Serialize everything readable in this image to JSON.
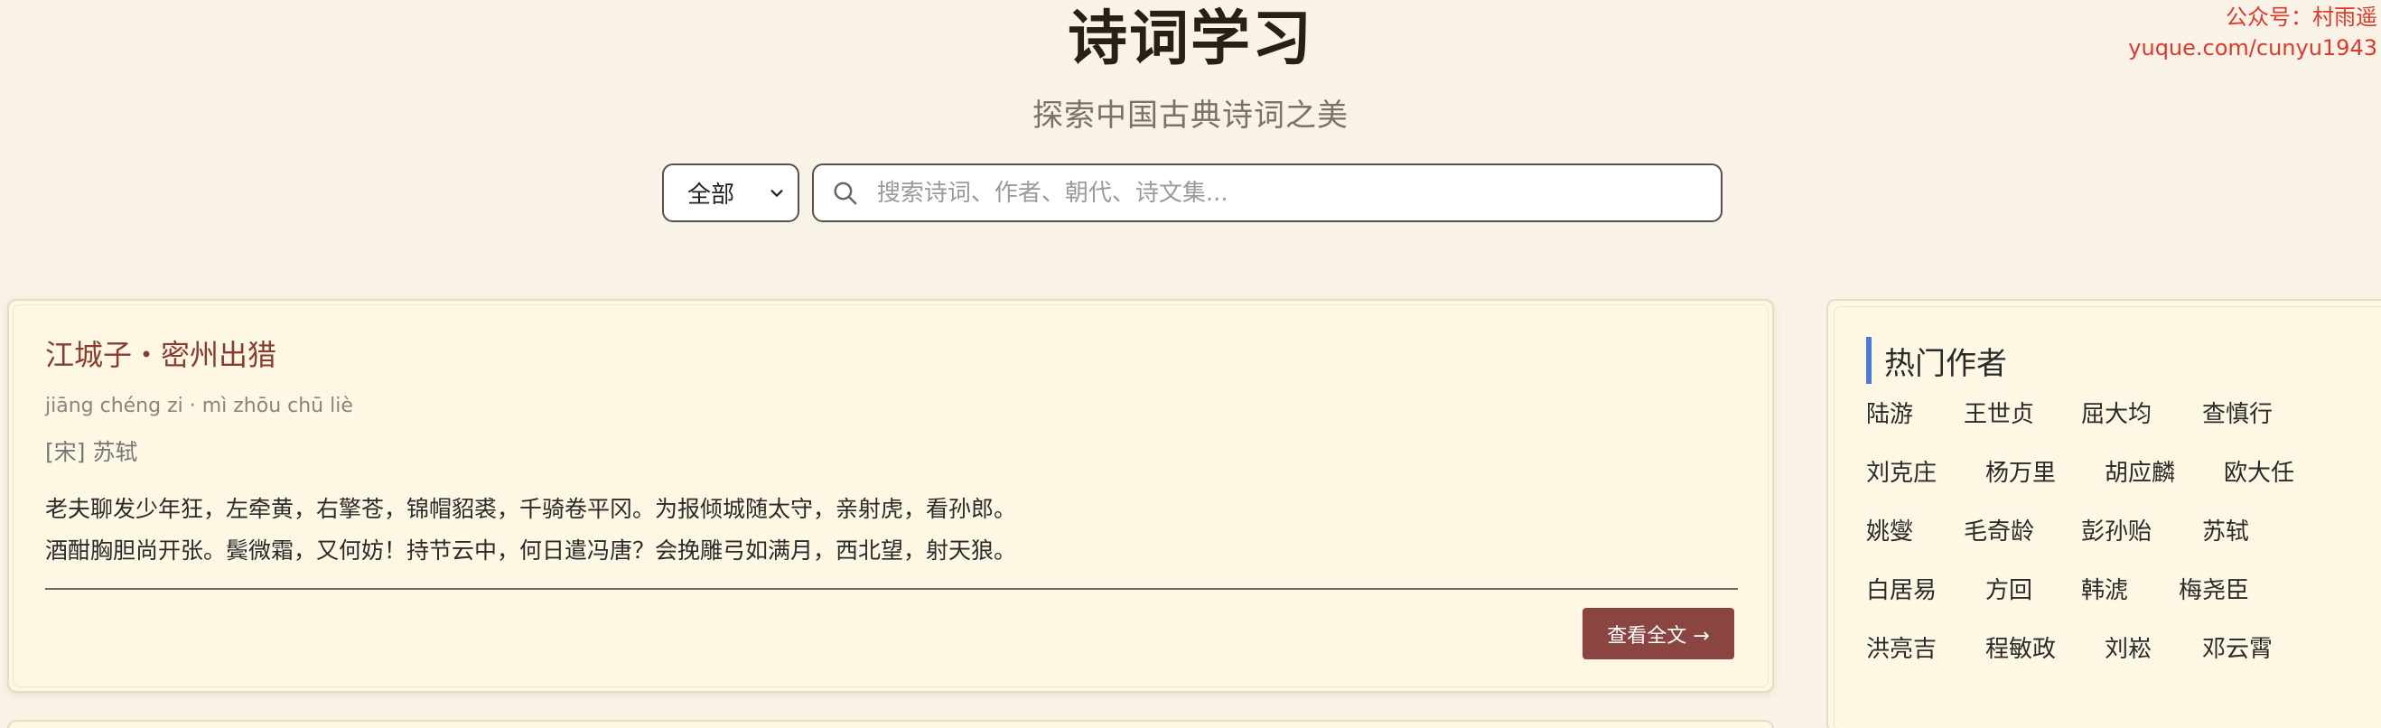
{
  "watermark": {
    "line1": "公众号：村雨遥",
    "line2": "yuque.com/cunyu1943"
  },
  "header": {
    "title": "诗词学习",
    "subtitle": "探索中国古典诗词之美"
  },
  "search": {
    "category_selected": "全部",
    "placeholder": "搜索诗词、作者、朝代、诗文集..."
  },
  "poem": {
    "title": "江城子・密州出猎",
    "pinyin": "jiāng chéng zi · mì zhōu chū liè",
    "author": "[宋] 苏轼",
    "lines": [
      "老夫聊发少年狂，左牵黄，右擎苍，锦帽貂裘，千骑卷平冈。为报倾城随太守，亲射虎，看孙郎。",
      "酒酣胸胆尚开张。鬓微霜，又何妨！持节云中，何日遣冯唐？会挽雕弓如满月，西北望，射天狼。"
    ],
    "read_more_label": "查看全文 →"
  },
  "sidebar": {
    "heading": "热门作者",
    "authors": [
      "陆游",
      "王世贞",
      "屈大均",
      "查慎行",
      "刘克庄",
      "杨万里",
      "胡应麟",
      "欧大任",
      "姚燮",
      "毛奇龄",
      "彭孙贻",
      "苏轼",
      "白居易",
      "方回",
      "韩淲",
      "梅尧臣",
      "洪亮吉",
      "程敏政",
      "刘崧",
      "邓云霄"
    ]
  },
  "colors": {
    "background": "#f8f3e6",
    "card": "#fdf7e3",
    "title_accent": "#8b3a2f",
    "button": "#8b4540",
    "heading_bar": "#4a7bd8",
    "watermark": "#e0392b"
  }
}
